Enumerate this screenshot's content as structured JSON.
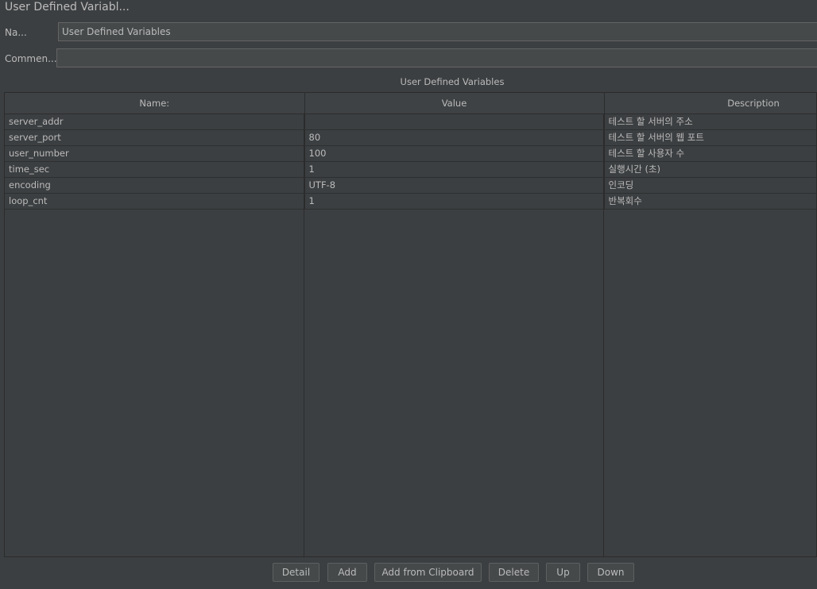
{
  "window": {
    "title": "User Defined Variabl..."
  },
  "name_field": {
    "label": "Na...",
    "value": "User Defined Variables"
  },
  "comments_field": {
    "label": "Commen...",
    "value": ""
  },
  "table": {
    "caption": "User Defined Variables",
    "columns": [
      "Name:",
      "Value",
      "Description"
    ],
    "rows": [
      {
        "name": "server_addr",
        "value": "",
        "description": "테스트 할 서버의 주소"
      },
      {
        "name": "server_port",
        "value": "80",
        "description": "테스트 할 서버의 웹 포트"
      },
      {
        "name": "user_number",
        "value": "100",
        "description": "테스트 할 사용자 수"
      },
      {
        "name": "time_sec",
        "value": "1",
        "description": "실행시간 (초)"
      },
      {
        "name": "encoding",
        "value": "UTF-8",
        "description": "인코딩"
      },
      {
        "name": "loop_cnt",
        "value": "1",
        "description": "반복회수"
      }
    ]
  },
  "buttons": {
    "detail": "Detail",
    "add": "Add",
    "add_from_clipboard": "Add from Clipboard",
    "delete": "Delete",
    "up": "Up",
    "down": "Down"
  },
  "colors": {
    "background": "#3c3f41",
    "input_background": "#45494a",
    "text": "#bbbbbb",
    "grid_line": "#2b2b2b"
  }
}
